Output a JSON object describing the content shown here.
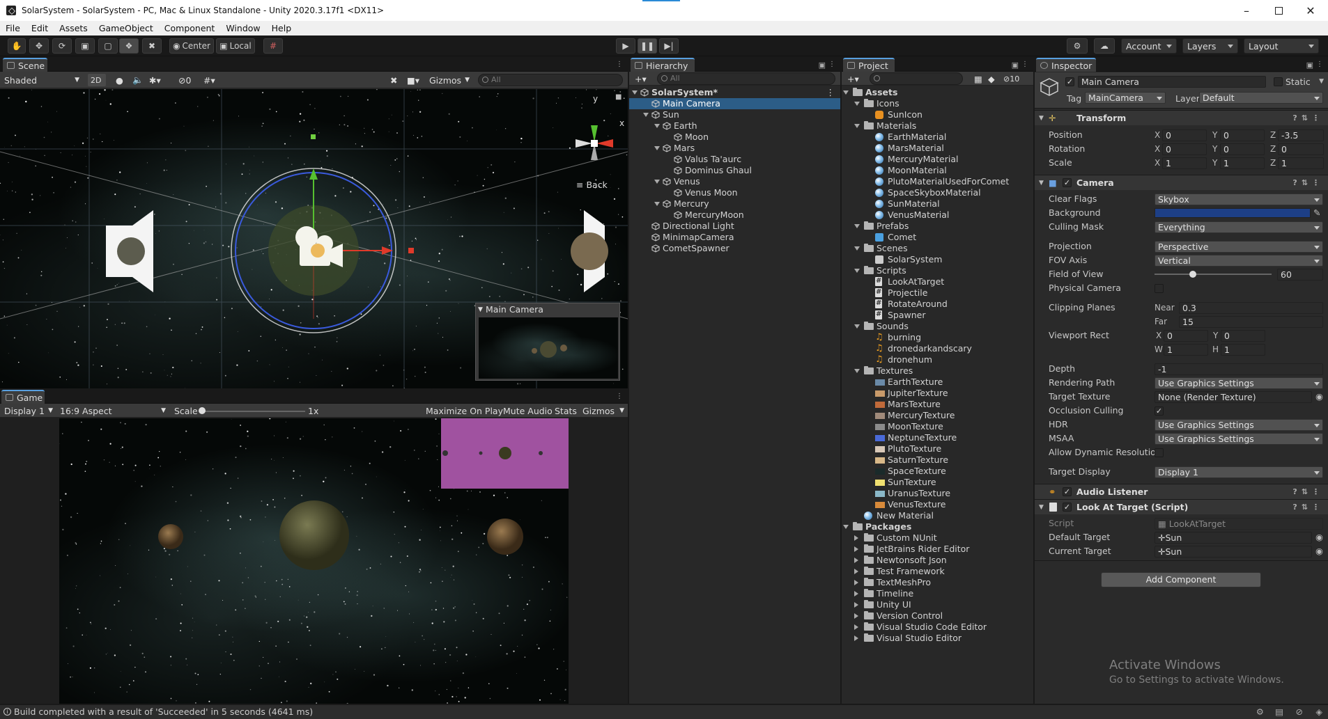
{
  "window": {
    "title": "SolarSystem - SolarSystem - PC, Mac & Linux Standalone - Unity 2020.3.17f1 <DX11>"
  },
  "menu": [
    "File",
    "Edit",
    "Assets",
    "GameObject",
    "Component",
    "Window",
    "Help"
  ],
  "toolbar": {
    "pivot_label": "Center",
    "space_label": "Local",
    "account_label": "Account",
    "layers_label": "Layers",
    "layout_label": "Layout"
  },
  "scene": {
    "tab": "Scene",
    "shading": "Shaded",
    "mode_2d": "2D",
    "hidden_count": "0",
    "gizmos": "Gizmos",
    "search_placeholder": "All",
    "back_label": "Back",
    "axis_y": "y",
    "axis_x": "x",
    "preview_title": "Main Camera"
  },
  "game": {
    "tab": "Game",
    "display": "Display 1",
    "aspect": "16:9 Aspect",
    "scale_label": "Scale",
    "scale_value": "1x",
    "maximize": "Maximize On Play",
    "mute": "Mute Audio",
    "stats": "Stats",
    "gizmos": "Gizmos"
  },
  "hierarchy": {
    "tab": "Hierarchy",
    "search_placeholder": "All",
    "items": [
      {
        "label": "SolarSystem*",
        "level": 0
      },
      {
        "label": "Main Camera",
        "level": 1,
        "selected": true
      },
      {
        "label": "Sun",
        "level": 1
      },
      {
        "label": "Earth",
        "level": 2
      },
      {
        "label": "Moon",
        "level": 3
      },
      {
        "label": "Mars",
        "level": 2
      },
      {
        "label": "Valus Ta'aurc",
        "level": 3
      },
      {
        "label": "Dominus Ghaul",
        "level": 3
      },
      {
        "label": "Venus",
        "level": 2
      },
      {
        "label": "Venus Moon",
        "level": 3
      },
      {
        "label": "Mercury",
        "level": 2
      },
      {
        "label": "MercuryMoon",
        "level": 3
      },
      {
        "label": "Directional Light",
        "level": 1
      },
      {
        "label": "MinimapCamera",
        "level": 1
      },
      {
        "label": "CometSpawner",
        "level": 1
      }
    ]
  },
  "project": {
    "tab": "Project",
    "hidden_count": "10",
    "items": [
      {
        "label": "Assets",
        "level": 0,
        "kind": "folder",
        "bold": true
      },
      {
        "label": "Icons",
        "level": 1,
        "kind": "folder"
      },
      {
        "label": "SunIcon",
        "level": 2,
        "kind": "sunicon"
      },
      {
        "label": "Materials",
        "level": 1,
        "kind": "folder"
      },
      {
        "label": "EarthMaterial",
        "level": 2,
        "kind": "material"
      },
      {
        "label": "MarsMaterial",
        "level": 2,
        "kind": "material"
      },
      {
        "label": "MercuryMaterial",
        "level": 2,
        "kind": "material"
      },
      {
        "label": "MoonMaterial",
        "level": 2,
        "kind": "material"
      },
      {
        "label": "PlutoMaterialUsedForComet",
        "level": 2,
        "kind": "material"
      },
      {
        "label": "SpaceSkyboxMaterial",
        "level": 2,
        "kind": "material"
      },
      {
        "label": "SunMaterial",
        "level": 2,
        "kind": "material"
      },
      {
        "label": "VenusMaterial",
        "level": 2,
        "kind": "material"
      },
      {
        "label": "Prefabs",
        "level": 1,
        "kind": "folder"
      },
      {
        "label": "Comet",
        "level": 2,
        "kind": "prefab"
      },
      {
        "label": "Scenes",
        "level": 1,
        "kind": "folder"
      },
      {
        "label": "SolarSystem",
        "level": 2,
        "kind": "scene"
      },
      {
        "label": "Scripts",
        "level": 1,
        "kind": "folder"
      },
      {
        "label": "LookAtTarget",
        "level": 2,
        "kind": "script"
      },
      {
        "label": "Projectile",
        "level": 2,
        "kind": "script"
      },
      {
        "label": "RotateAround",
        "level": 2,
        "kind": "script"
      },
      {
        "label": "Spawner",
        "level": 2,
        "kind": "script"
      },
      {
        "label": "Sounds",
        "level": 1,
        "kind": "folder"
      },
      {
        "label": "burning",
        "level": 2,
        "kind": "sound"
      },
      {
        "label": "dronedarkandscary",
        "level": 2,
        "kind": "sound"
      },
      {
        "label": "dronehum",
        "level": 2,
        "kind": "sound"
      },
      {
        "label": "Textures",
        "level": 1,
        "kind": "folder"
      },
      {
        "label": "EarthTexture",
        "level": 2,
        "kind": "texture",
        "color": "#6a8aa8"
      },
      {
        "label": "JupiterTexture",
        "level": 2,
        "kind": "texture",
        "color": "#c89a6a"
      },
      {
        "label": "MarsTexture",
        "level": 2,
        "kind": "texture",
        "color": "#c06a3a"
      },
      {
        "label": "MercuryTexture",
        "level": 2,
        "kind": "texture",
        "color": "#a08a7a"
      },
      {
        "label": "MoonTexture",
        "level": 2,
        "kind": "texture",
        "color": "#8a8a8a"
      },
      {
        "label": "NeptuneTexture",
        "level": 2,
        "kind": "texture",
        "color": "#4a6ad8"
      },
      {
        "label": "PlutoTexture",
        "level": 2,
        "kind": "texture",
        "color": "#d8c8b8"
      },
      {
        "label": "SaturnTexture",
        "level": 2,
        "kind": "texture",
        "color": "#d8b888"
      },
      {
        "label": "SpaceTexture",
        "level": 2,
        "kind": "texture",
        "color": "#1a2a2a"
      },
      {
        "label": "SunTexture",
        "level": 2,
        "kind": "texture",
        "color": "#f0e070"
      },
      {
        "label": "UranusTexture",
        "level": 2,
        "kind": "texture",
        "color": "#8ab8c8"
      },
      {
        "label": "VenusTexture",
        "level": 2,
        "kind": "texture",
        "color": "#d88a3a"
      },
      {
        "label": "New Material",
        "level": 1,
        "kind": "material"
      },
      {
        "label": "Packages",
        "level": 0,
        "kind": "folder",
        "bold": true
      },
      {
        "label": "Custom NUnit",
        "level": 1,
        "kind": "folder",
        "collapsed": true
      },
      {
        "label": "JetBrains Rider Editor",
        "level": 1,
        "kind": "folder",
        "collapsed": true
      },
      {
        "label": "Newtonsoft Json",
        "level": 1,
        "kind": "folder",
        "collapsed": true
      },
      {
        "label": "Test Framework",
        "level": 1,
        "kind": "folder",
        "collapsed": true
      },
      {
        "label": "TextMeshPro",
        "level": 1,
        "kind": "folder",
        "collapsed": true
      },
      {
        "label": "Timeline",
        "level": 1,
        "kind": "folder",
        "collapsed": true
      },
      {
        "label": "Unity UI",
        "level": 1,
        "kind": "folder",
        "collapsed": true
      },
      {
        "label": "Version Control",
        "level": 1,
        "kind": "folder",
        "collapsed": true
      },
      {
        "label": "Visual Studio Code Editor",
        "level": 1,
        "kind": "folder",
        "collapsed": true
      },
      {
        "label": "Visual Studio Editor",
        "level": 1,
        "kind": "folder",
        "collapsed": true
      }
    ]
  },
  "inspector": {
    "tab": "Inspector",
    "object_name": "Main Camera",
    "static_label": "Static",
    "tag_label": "Tag",
    "tag_value": "MainCamera",
    "layer_label": "Layer",
    "layer_value": "Default",
    "transform": {
      "title": "Transform",
      "position_label": "Position",
      "rotation_label": "Rotation",
      "scale_label": "Scale",
      "px": "0",
      "py": "0",
      "pz": "-3.5",
      "rx": "0",
      "ry": "0",
      "rz": "0",
      "sx": "1",
      "sy": "1",
      "sz": "1"
    },
    "camera": {
      "title": "Camera",
      "clear_flags_label": "Clear Flags",
      "clear_flags": "Skybox",
      "background_label": "Background",
      "background_color": "#1d3f86",
      "culling_label": "Culling Mask",
      "culling": "Everything",
      "projection_label": "Projection",
      "projection": "Perspective",
      "fov_axis_label": "FOV Axis",
      "fov_axis": "Vertical",
      "fov_label": "Field of View",
      "fov": "60",
      "fov_fraction": 0.33,
      "physical_label": "Physical Camera",
      "clipping_label": "Clipping Planes",
      "near_label": "Near",
      "near": "0.3",
      "far_label": "Far",
      "far": "15",
      "viewport_label": "Viewport Rect",
      "vx": "0",
      "vy": "0",
      "vw": "1",
      "vh": "1",
      "depth_label": "Depth",
      "depth": "-1",
      "rendering_path_label": "Rendering Path",
      "rendering_path": "Use Graphics Settings",
      "target_texture_label": "Target Texture",
      "target_texture": "None (Render Texture)",
      "occlusion_label": "Occlusion Culling",
      "hdr_label": "HDR",
      "hdr": "Use Graphics Settings",
      "msaa_label": "MSAA",
      "msaa": "Use Graphics Settings",
      "dynres_label": "Allow Dynamic Resolution",
      "target_display_label": "Target Display",
      "target_display": "Display 1"
    },
    "audio_listener": {
      "title": "Audio Listener"
    },
    "look_at": {
      "title": "Look At Target (Script)",
      "script_label": "Script",
      "script": "LookAtTarget",
      "default_label": "Default Target",
      "default_target": "Sun",
      "current_label": "Current Target",
      "current_target": "Sun"
    },
    "add_component": "Add Component",
    "watermark_title": "Activate Windows",
    "watermark_sub": "Go to Settings to activate Windows."
  },
  "status": {
    "message": "Build completed with a result of 'Succeeded' in 5 seconds (4641 ms)"
  }
}
